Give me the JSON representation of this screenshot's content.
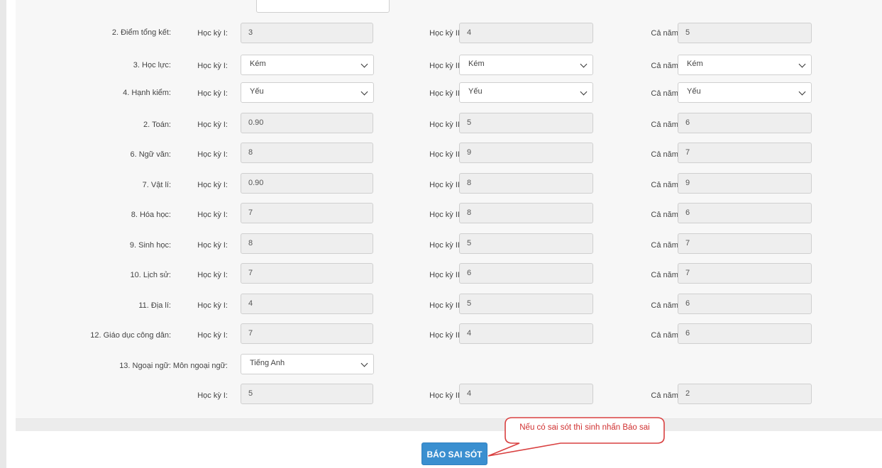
{
  "rows": [
    {
      "label": "2. Điểm tổng kết:",
      "hk1_label": "Học kỳ I:",
      "hk1": "3",
      "hk2_label": "Học kỳ II:",
      "hk2": "4",
      "cn_label": "Cả năm:",
      "cn": "5"
    },
    {
      "label": "3. Học lực:",
      "hk1_label": "Học kỳ I:",
      "hk1": "Kém",
      "hk2_label": "Học kỳ II:",
      "hk2": "Kém",
      "cn_label": "Cả năm:",
      "cn": "Kém"
    },
    {
      "label": "4. Hạnh kiểm:",
      "hk1_label": "Học kỳ I:",
      "hk1": "Yếu",
      "hk2_label": "Học kỳ II:",
      "hk2": "Yếu",
      "cn_label": "Cả năm:",
      "cn": "Yếu"
    },
    {
      "label": "2. Toán:",
      "hk1_label": "Học kỳ I:",
      "hk1": "0.90",
      "hk2_label": "Học kỳ II:",
      "hk2": "5",
      "cn_label": "Cả năm:",
      "cn": "6"
    },
    {
      "label": "6. Ngữ văn:",
      "hk1_label": "Học kỳ I:",
      "hk1": "8",
      "hk2_label": "Học kỳ II:",
      "hk2": "9",
      "cn_label": "Cả năm:",
      "cn": "7"
    },
    {
      "label": "7. Vật lí:",
      "hk1_label": "Học kỳ I:",
      "hk1": "0.90",
      "hk2_label": "Học kỳ II:",
      "hk2": "8",
      "cn_label": "Cả năm:",
      "cn": "9"
    },
    {
      "label": "8. Hóa học:",
      "hk1_label": "Học kỳ I:",
      "hk1": "7",
      "hk2_label": "Học kỳ II:",
      "hk2": "8",
      "cn_label": "Cả năm:",
      "cn": "6"
    },
    {
      "label": "9. Sinh học:",
      "hk1_label": "Học kỳ I:",
      "hk1": "8",
      "hk2_label": "Học kỳ II:",
      "hk2": "5",
      "cn_label": "Cả năm:",
      "cn": "7"
    },
    {
      "label": "10. Lịch sử:",
      "hk1_label": "Học kỳ I:",
      "hk1": "7",
      "hk2_label": "Học kỳ II:",
      "hk2": "6",
      "cn_label": "Cả năm:",
      "cn": "7"
    },
    {
      "label": "11. Địa lí:",
      "hk1_label": "Học kỳ I:",
      "hk1": "4",
      "hk2_label": "Học kỳ II:",
      "hk2": "5",
      "cn_label": "Cả năm:",
      "cn": "6"
    },
    {
      "label": "12. Giáo dục công dân:",
      "hk1_label": "Học kỳ I:",
      "hk1": "7",
      "hk2_label": "Học kỳ II:",
      "hk2": "4",
      "cn_label": "Cả năm:",
      "cn": "6"
    }
  ],
  "foreign_language": {
    "label": "13. Ngoại ngữ:",
    "subject_label": "Môn ngoại ngữ:",
    "subject": "Tiếng Anh",
    "hk1_label": "Học kỳ I:",
    "hk1": "5",
    "hk2_label": "Học kỳ II:",
    "hk2": "4",
    "cn_label": "Cả năm:",
    "cn": "2"
  },
  "report_button": "BÁO SAI SÓT",
  "callout": "Nếu có sai sót thì sinh nhấn Báo sai",
  "colors": {
    "button": "#3a8fd0",
    "callout_border": "#d94040",
    "callout_text": "#d03030"
  }
}
